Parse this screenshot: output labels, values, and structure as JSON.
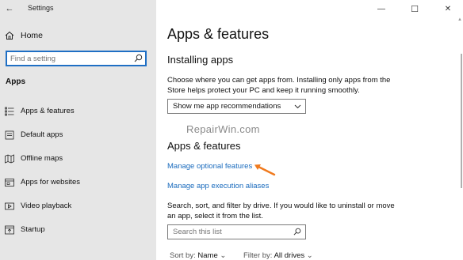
{
  "window": {
    "title": "Settings",
    "minimize_glyph": "—",
    "maximize_glyph": "☐",
    "close_glyph": "✕",
    "back_glyph": "←"
  },
  "sidebar": {
    "home_label": "Home",
    "search_placeholder": "Find a setting",
    "section_label": "Apps",
    "items": [
      {
        "label": "Apps & features",
        "icon": "apps-features-icon"
      },
      {
        "label": "Default apps",
        "icon": "default-apps-icon"
      },
      {
        "label": "Offline maps",
        "icon": "offline-maps-icon"
      },
      {
        "label": "Apps for websites",
        "icon": "apps-for-websites-icon"
      },
      {
        "label": "Video playback",
        "icon": "video-playback-icon"
      },
      {
        "label": "Startup",
        "icon": "startup-icon"
      }
    ]
  },
  "main": {
    "page_title": "Apps & features",
    "installing_heading": "Installing apps",
    "installing_desc": "Choose where you can get apps from. Installing only apps from the Store helps protect your PC and keep it running smoothly.",
    "install_dropdown_value": "Show me app recommendations",
    "watermark": "RepairWin.com",
    "apps_heading": "Apps & features",
    "link_optional": "Manage optional features",
    "link_aliases": "Manage app execution aliases",
    "search_desc": "Search, sort, and filter by drive. If you would like to uninstall or move an app, select it from the list.",
    "list_search_placeholder": "Search this list",
    "sort_label": "Sort by:",
    "sort_value": "Name",
    "filter_label": "Filter by:",
    "filter_value": "All drives"
  },
  "colors": {
    "accent": "#1f6fc4",
    "link": "#1a6bbd",
    "sidebar_bg": "#e6e6e6",
    "arrow": "#f07a1e"
  }
}
